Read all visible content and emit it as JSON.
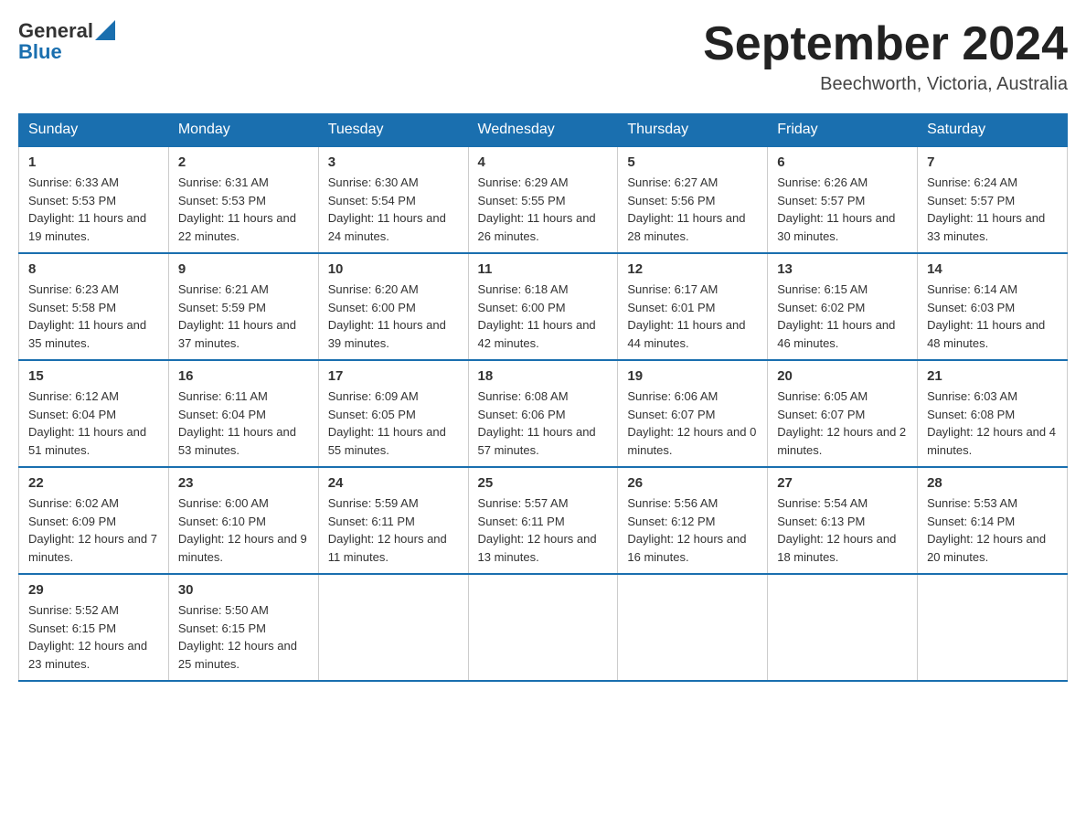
{
  "logo": {
    "general": "General",
    "blue": "Blue"
  },
  "title": {
    "month_year": "September 2024",
    "location": "Beechworth, Victoria, Australia"
  },
  "days_of_week": [
    "Sunday",
    "Monday",
    "Tuesday",
    "Wednesday",
    "Thursday",
    "Friday",
    "Saturday"
  ],
  "weeks": [
    [
      {
        "day": "1",
        "sunrise": "6:33 AM",
        "sunset": "5:53 PM",
        "daylight": "11 hours and 19 minutes."
      },
      {
        "day": "2",
        "sunrise": "6:31 AM",
        "sunset": "5:53 PM",
        "daylight": "11 hours and 22 minutes."
      },
      {
        "day": "3",
        "sunrise": "6:30 AM",
        "sunset": "5:54 PM",
        "daylight": "11 hours and 24 minutes."
      },
      {
        "day": "4",
        "sunrise": "6:29 AM",
        "sunset": "5:55 PM",
        "daylight": "11 hours and 26 minutes."
      },
      {
        "day": "5",
        "sunrise": "6:27 AM",
        "sunset": "5:56 PM",
        "daylight": "11 hours and 28 minutes."
      },
      {
        "day": "6",
        "sunrise": "6:26 AM",
        "sunset": "5:57 PM",
        "daylight": "11 hours and 30 minutes."
      },
      {
        "day": "7",
        "sunrise": "6:24 AM",
        "sunset": "5:57 PM",
        "daylight": "11 hours and 33 minutes."
      }
    ],
    [
      {
        "day": "8",
        "sunrise": "6:23 AM",
        "sunset": "5:58 PM",
        "daylight": "11 hours and 35 minutes."
      },
      {
        "day": "9",
        "sunrise": "6:21 AM",
        "sunset": "5:59 PM",
        "daylight": "11 hours and 37 minutes."
      },
      {
        "day": "10",
        "sunrise": "6:20 AM",
        "sunset": "6:00 PM",
        "daylight": "11 hours and 39 minutes."
      },
      {
        "day": "11",
        "sunrise": "6:18 AM",
        "sunset": "6:00 PM",
        "daylight": "11 hours and 42 minutes."
      },
      {
        "day": "12",
        "sunrise": "6:17 AM",
        "sunset": "6:01 PM",
        "daylight": "11 hours and 44 minutes."
      },
      {
        "day": "13",
        "sunrise": "6:15 AM",
        "sunset": "6:02 PM",
        "daylight": "11 hours and 46 minutes."
      },
      {
        "day": "14",
        "sunrise": "6:14 AM",
        "sunset": "6:03 PM",
        "daylight": "11 hours and 48 minutes."
      }
    ],
    [
      {
        "day": "15",
        "sunrise": "6:12 AM",
        "sunset": "6:04 PM",
        "daylight": "11 hours and 51 minutes."
      },
      {
        "day": "16",
        "sunrise": "6:11 AM",
        "sunset": "6:04 PM",
        "daylight": "11 hours and 53 minutes."
      },
      {
        "day": "17",
        "sunrise": "6:09 AM",
        "sunset": "6:05 PM",
        "daylight": "11 hours and 55 minutes."
      },
      {
        "day": "18",
        "sunrise": "6:08 AM",
        "sunset": "6:06 PM",
        "daylight": "11 hours and 57 minutes."
      },
      {
        "day": "19",
        "sunrise": "6:06 AM",
        "sunset": "6:07 PM",
        "daylight": "12 hours and 0 minutes."
      },
      {
        "day": "20",
        "sunrise": "6:05 AM",
        "sunset": "6:07 PM",
        "daylight": "12 hours and 2 minutes."
      },
      {
        "day": "21",
        "sunrise": "6:03 AM",
        "sunset": "6:08 PM",
        "daylight": "12 hours and 4 minutes."
      }
    ],
    [
      {
        "day": "22",
        "sunrise": "6:02 AM",
        "sunset": "6:09 PM",
        "daylight": "12 hours and 7 minutes."
      },
      {
        "day": "23",
        "sunrise": "6:00 AM",
        "sunset": "6:10 PM",
        "daylight": "12 hours and 9 minutes."
      },
      {
        "day": "24",
        "sunrise": "5:59 AM",
        "sunset": "6:11 PM",
        "daylight": "12 hours and 11 minutes."
      },
      {
        "day": "25",
        "sunrise": "5:57 AM",
        "sunset": "6:11 PM",
        "daylight": "12 hours and 13 minutes."
      },
      {
        "day": "26",
        "sunrise": "5:56 AM",
        "sunset": "6:12 PM",
        "daylight": "12 hours and 16 minutes."
      },
      {
        "day": "27",
        "sunrise": "5:54 AM",
        "sunset": "6:13 PM",
        "daylight": "12 hours and 18 minutes."
      },
      {
        "day": "28",
        "sunrise": "5:53 AM",
        "sunset": "6:14 PM",
        "daylight": "12 hours and 20 minutes."
      }
    ],
    [
      {
        "day": "29",
        "sunrise": "5:52 AM",
        "sunset": "6:15 PM",
        "daylight": "12 hours and 23 minutes."
      },
      {
        "day": "30",
        "sunrise": "5:50 AM",
        "sunset": "6:15 PM",
        "daylight": "12 hours and 25 minutes."
      },
      null,
      null,
      null,
      null,
      null
    ]
  ],
  "labels": {
    "sunrise": "Sunrise:",
    "sunset": "Sunset:",
    "daylight": "Daylight:"
  }
}
